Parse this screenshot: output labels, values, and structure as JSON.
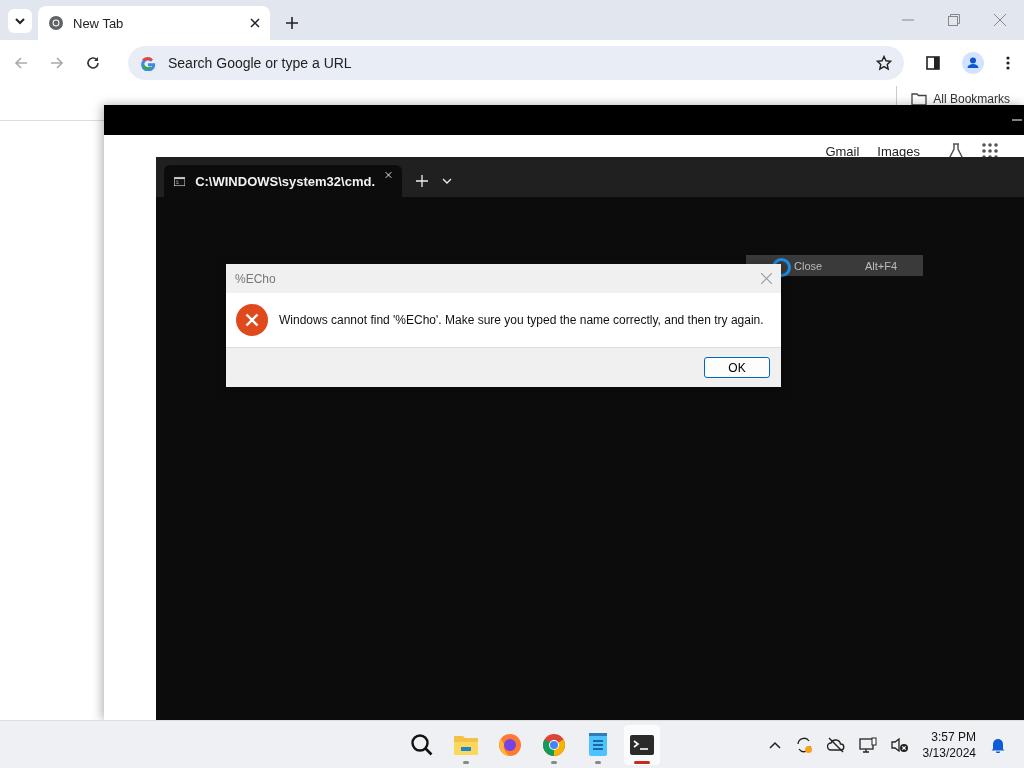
{
  "browser": {
    "tab": {
      "title": "New Tab",
      "selected": true
    },
    "address": {
      "placeholder": "Search Google or type a URL"
    },
    "bookmarks": {
      "label": "All Bookmarks"
    }
  },
  "back_window": {
    "links": [
      "Gmail",
      "Images"
    ]
  },
  "terminal": {
    "tab": {
      "title": "C:\\WINDOWS\\system32\\cmd.",
      "selected": true
    }
  },
  "context_menu": {
    "items": [
      {
        "label": "Close",
        "shortcut": "Alt+F4"
      }
    ]
  },
  "dialog": {
    "title": "%ECho",
    "message": "Windows cannot find '%ECho'. Make sure you typed the name correctly, and then try again.",
    "buttons": [
      {
        "label": "OK",
        "default": true
      }
    ]
  },
  "taskbar": {
    "apps": [
      {
        "kind": "search",
        "running": false,
        "selected": false
      },
      {
        "kind": "files",
        "running": true,
        "selected": false
      },
      {
        "kind": "firefox",
        "running": false,
        "selected": false
      },
      {
        "kind": "chrome",
        "running": true,
        "selected": false
      },
      {
        "kind": "notepad",
        "running": true,
        "selected": false
      },
      {
        "kind": "terminal",
        "running": true,
        "selected": true
      }
    ],
    "clock": {
      "time": "3:57 PM",
      "date": "3/13/2024"
    }
  }
}
